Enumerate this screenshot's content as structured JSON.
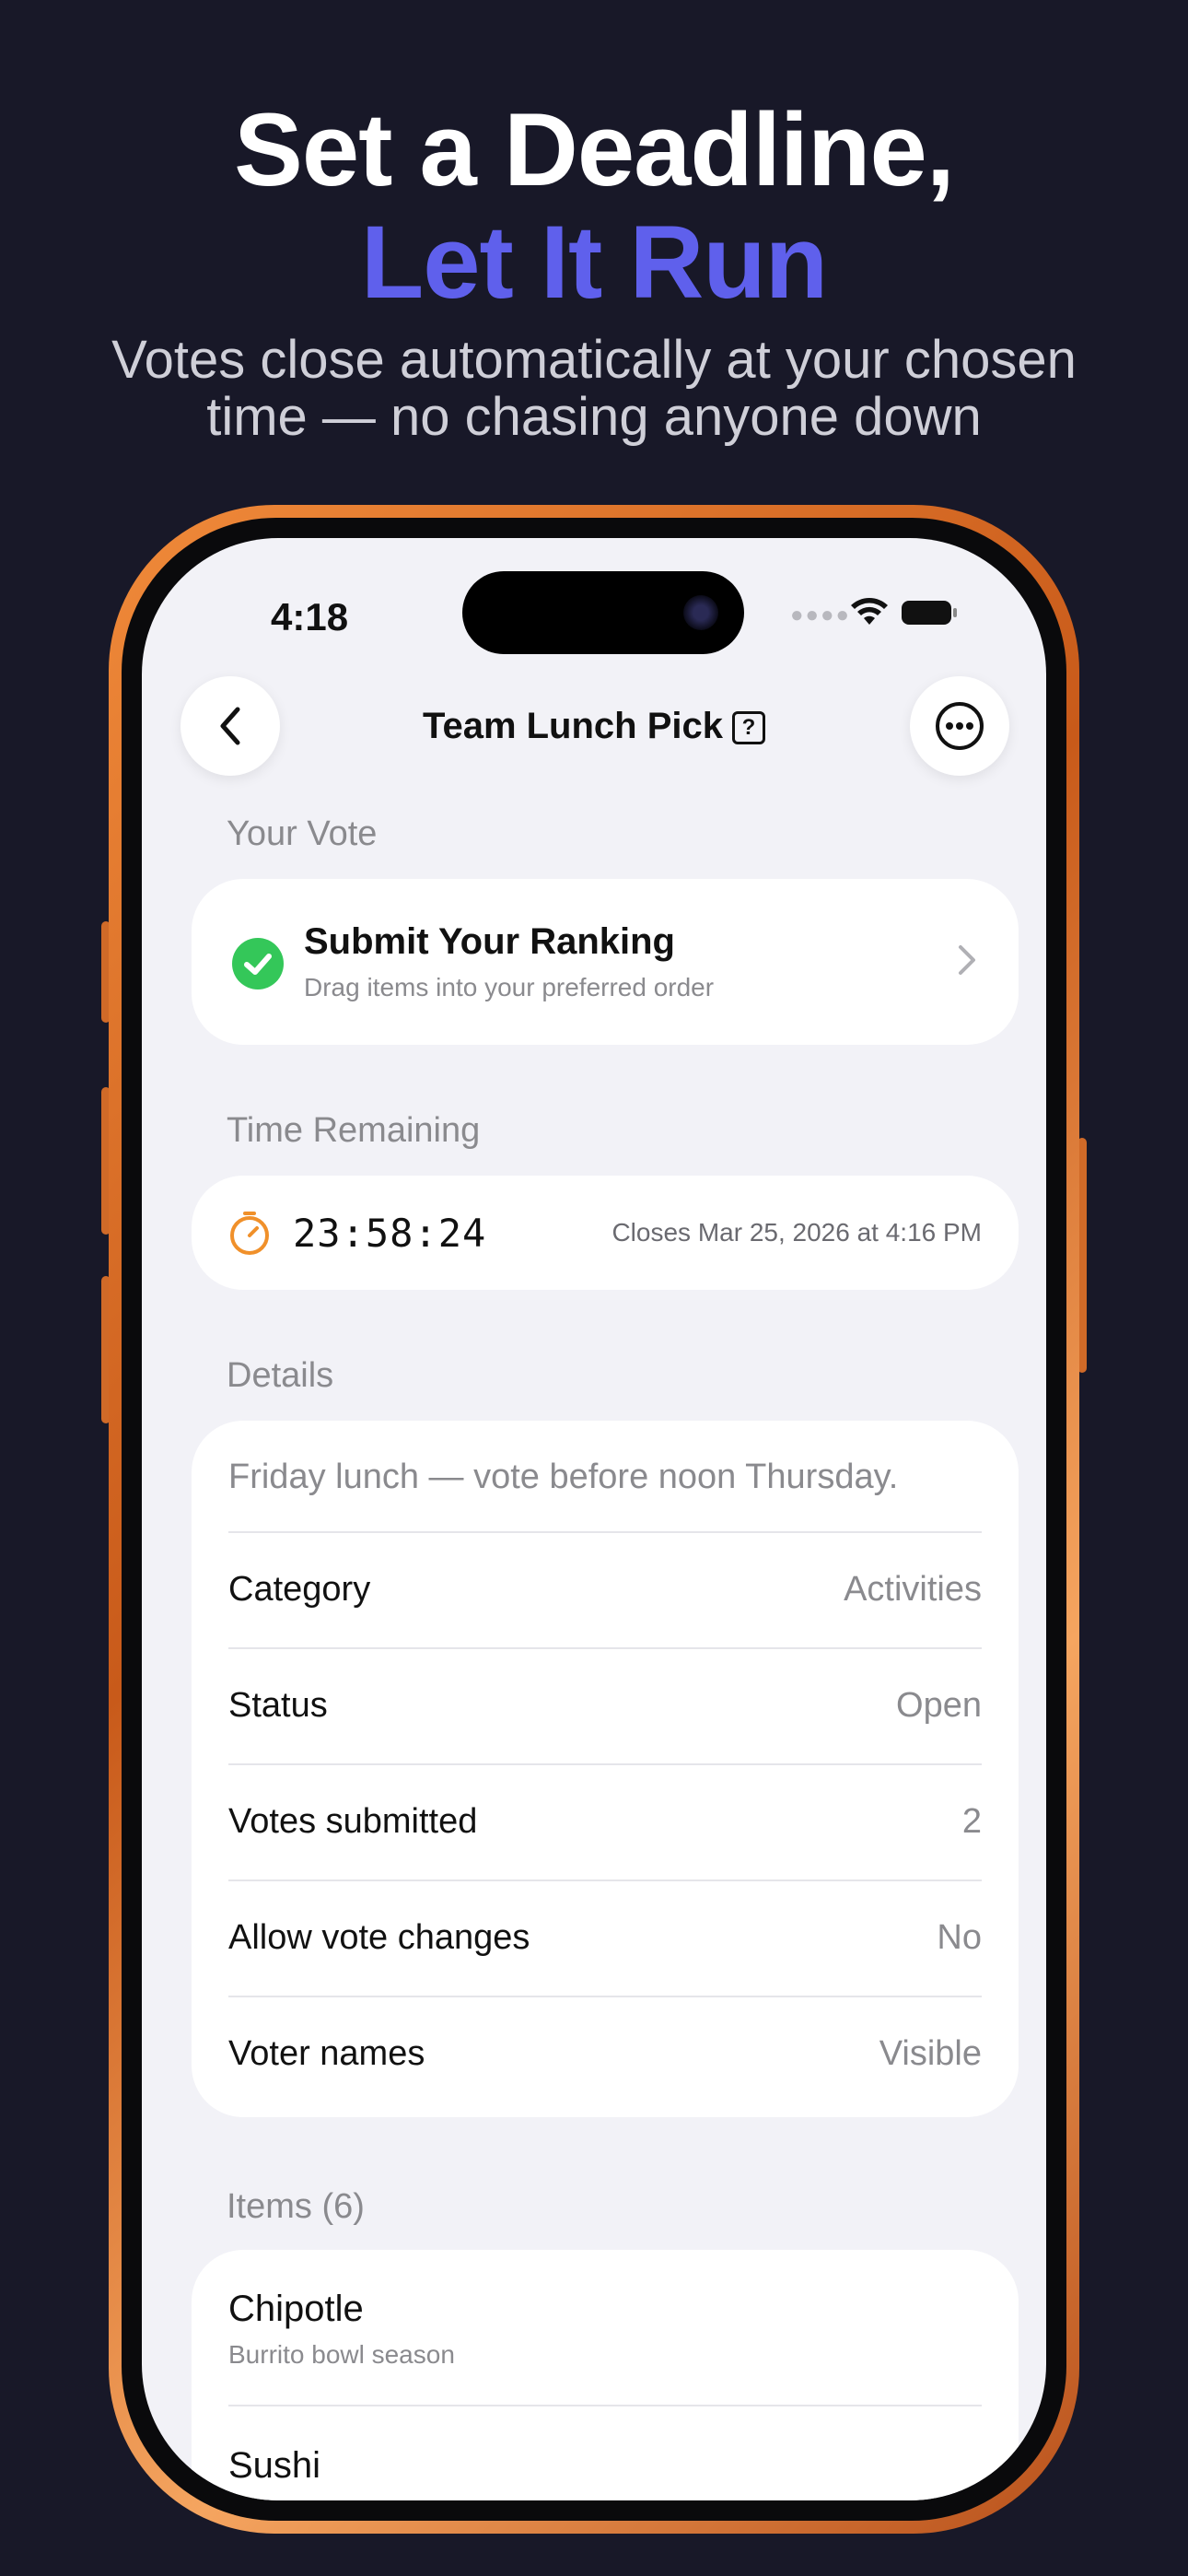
{
  "hero": {
    "line1": "Set a Deadline,",
    "line2": "Let It Run",
    "sub1": "Votes close automatically at your chosen",
    "sub2": "time — no chasing anyone down",
    "accent_color": "#5f60ec"
  },
  "status_bar": {
    "time": "4:18"
  },
  "nav": {
    "title": "Team Lunch Pick",
    "help_glyph": "?"
  },
  "your_vote": {
    "section": "Your Vote",
    "title": "Submit Your Ranking",
    "subtitle": "Drag items into your preferred order"
  },
  "time_remaining": {
    "section": "Time Remaining",
    "countdown": "23:58:24",
    "closes": "Closes Mar 25, 2026 at 4:16 PM"
  },
  "details": {
    "section": "Details",
    "description": "Friday lunch — vote before noon Thursday.",
    "rows": [
      {
        "key": "Category",
        "value": "Activities"
      },
      {
        "key": "Status",
        "value": "Open"
      },
      {
        "key": "Votes submitted",
        "value": "2"
      },
      {
        "key": "Allow vote changes",
        "value": "No"
      },
      {
        "key": "Voter names",
        "value": "Visible"
      }
    ]
  },
  "items": {
    "section": "Items (6)",
    "list": [
      {
        "name": "Chipotle",
        "note": "Burrito bowl season"
      },
      {
        "name": "Sushi",
        "note": ""
      }
    ]
  },
  "colors": {
    "frame": "#e07a30",
    "check": "#34c759",
    "timer_icon": "#f0902a"
  }
}
